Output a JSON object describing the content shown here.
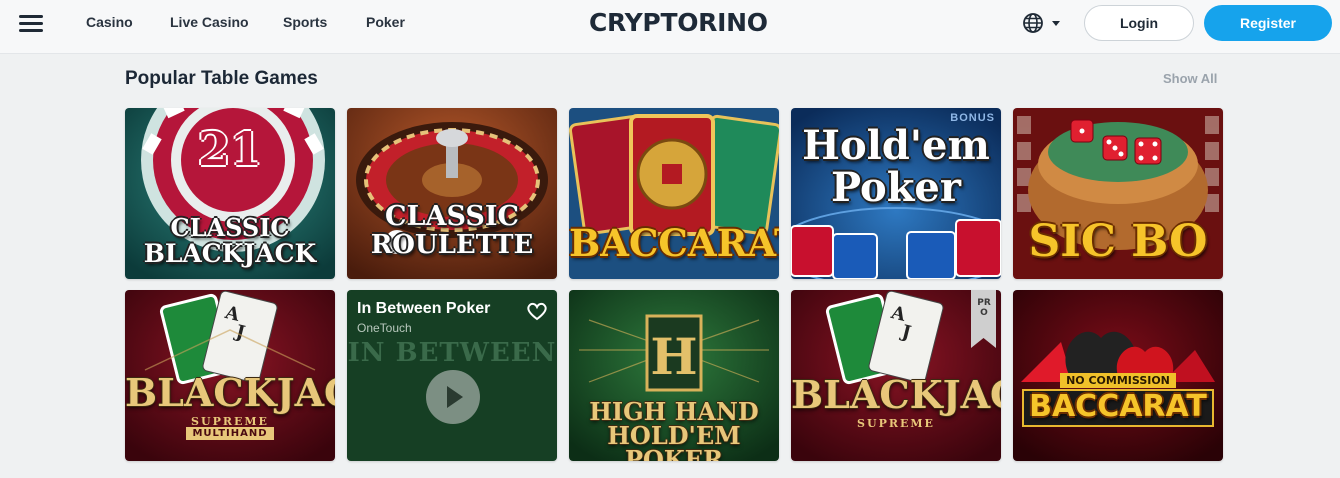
{
  "header": {
    "nav": [
      "Casino",
      "Live Casino",
      "Sports",
      "Poker"
    ],
    "logo": "CRYPTORINO",
    "login_label": "Login",
    "register_label": "Register"
  },
  "section": {
    "title": "Popular Table Games",
    "show_all": "Show All"
  },
  "games": [
    {
      "line1": "CLASSIC",
      "line2": "BLACKJACK",
      "badge": "21"
    },
    {
      "line1": "CLASSIC",
      "line2": "ROULETTE"
    },
    {
      "line1": "BACCARAT"
    },
    {
      "line1": "Hold'em",
      "line2": "Poker",
      "badge": "BONUS"
    },
    {
      "line1": "SIC BO"
    },
    {
      "line1": "BLACKJACK",
      "sub1": "SUPREME",
      "sub2": "MULTIHAND"
    },
    {
      "title": "In Between Poker",
      "provider": "OneTouch",
      "art_text": "IN BETWEEN"
    },
    {
      "line1": "HIGH HAND",
      "line2": "HOLD'EM POKER"
    },
    {
      "line1": "BLACKJACK",
      "sub1": "SUPREME",
      "badge": "PRO"
    },
    {
      "line1": "BACCARAT",
      "banner": "NO COMMISSION"
    }
  ],
  "colors": {
    "accent": "#16a3ec",
    "background": "#eff1f2",
    "header_bg": "#f7f8f9"
  },
  "icons": [
    "menu-icon",
    "globe-icon",
    "chevron-down-icon",
    "heart-icon",
    "play-icon"
  ]
}
